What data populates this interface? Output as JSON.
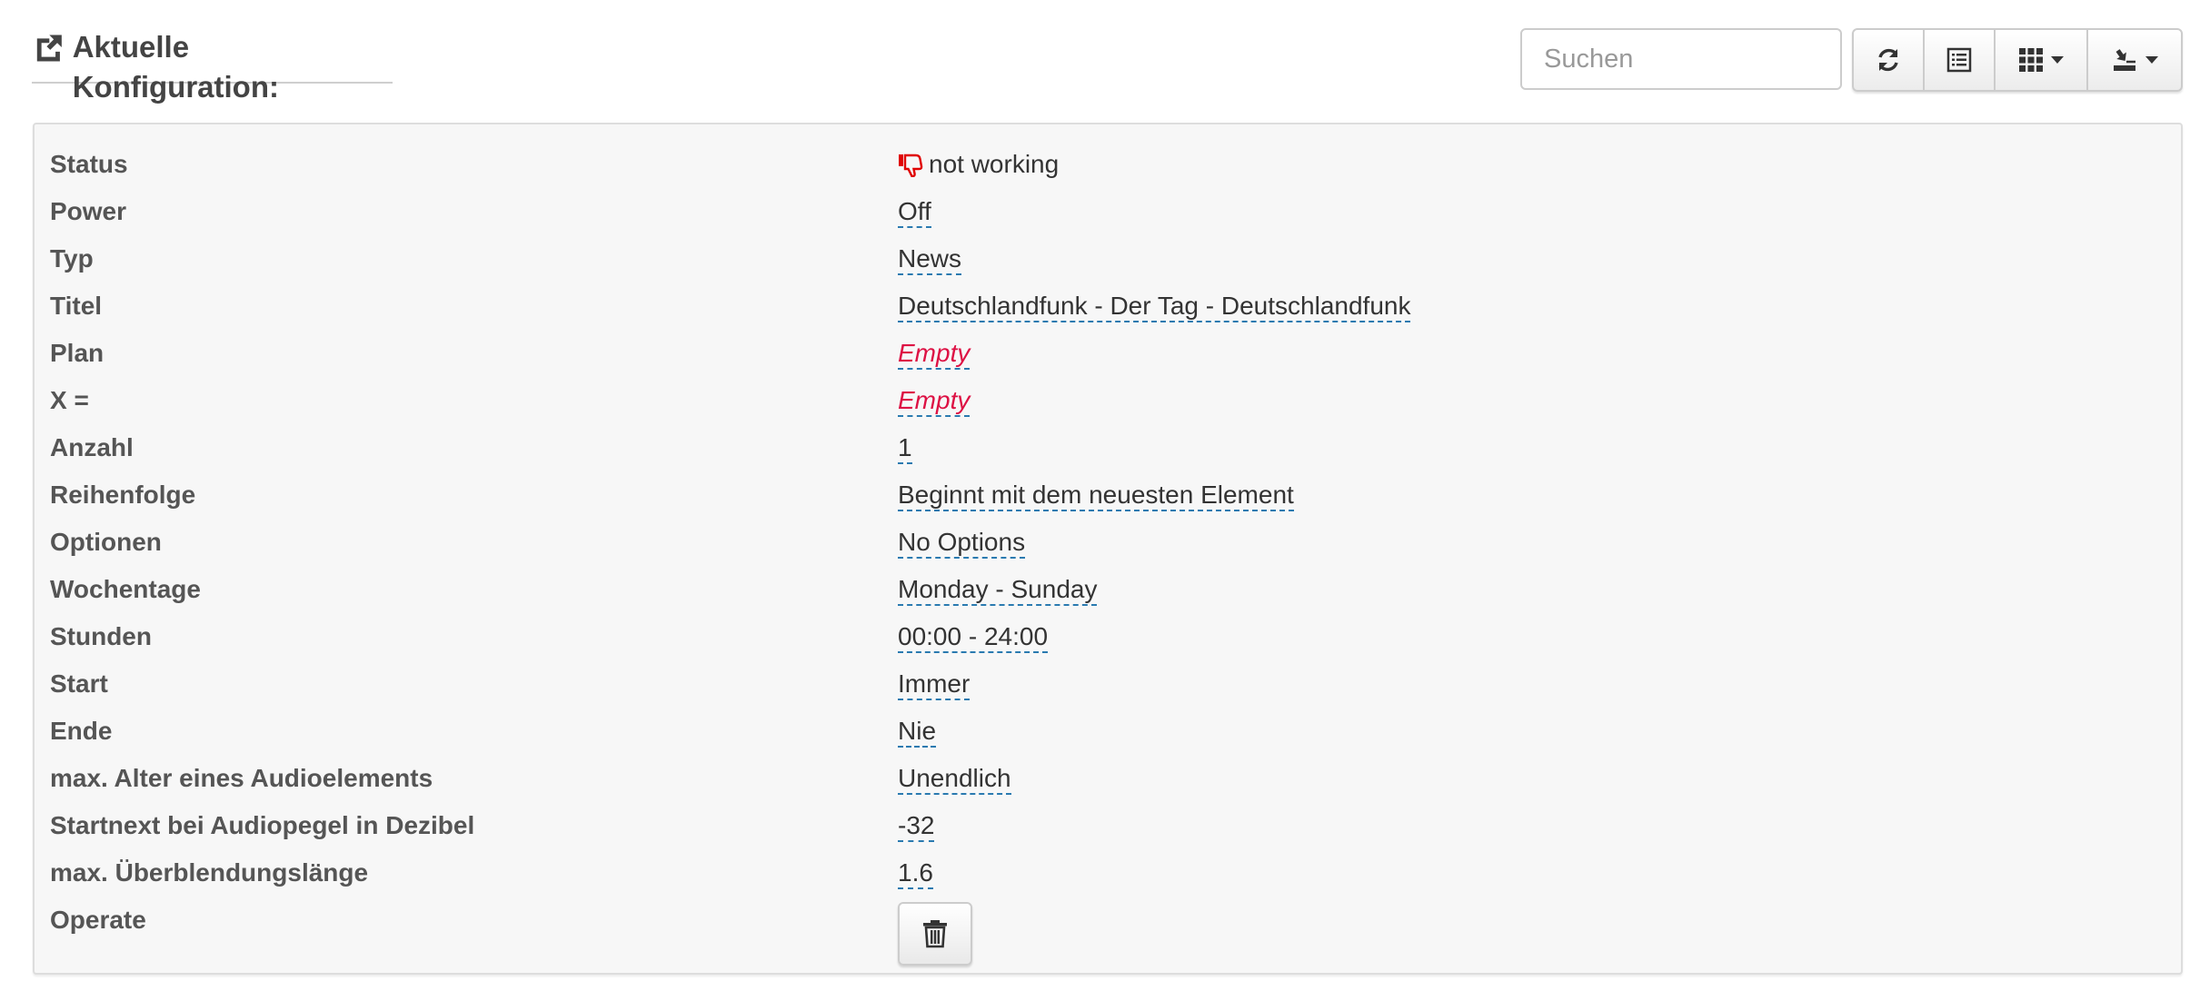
{
  "header": {
    "title": "Aktuelle Konfiguration:",
    "icon": "share-square-icon"
  },
  "toolbar": {
    "search_placeholder": "Suchen",
    "buttons": [
      {
        "icon": "refresh-icon"
      },
      {
        "icon": "list-view-icon"
      },
      {
        "icon": "columns-grid-icon",
        "dropdown": true
      },
      {
        "icon": "export-icon",
        "dropdown": true
      }
    ]
  },
  "colors": {
    "status_error": "#e00000",
    "empty_value": "#dd1144",
    "editable_underline": "#2a7ab0",
    "panel_background": "#f7f7f7"
  },
  "config": {
    "rows": [
      {
        "label": "Status",
        "value": "not working",
        "icon": "thumbs-down-icon"
      },
      {
        "label": "Power",
        "value": "Off"
      },
      {
        "label": "Typ",
        "value": "News"
      },
      {
        "label": "Titel",
        "value": "Deutschlandfunk - Der Tag - Deutschlandfunk"
      },
      {
        "label": "Plan",
        "value": "Empty"
      },
      {
        "label": "X =",
        "value": "Empty"
      },
      {
        "label": "Anzahl",
        "value": "1"
      },
      {
        "label": "Reihenfolge",
        "value": "Beginnt mit dem neuesten Element"
      },
      {
        "label": "Optionen",
        "value": "No Options"
      },
      {
        "label": "Wochentage",
        "value": "Monday - Sunday"
      },
      {
        "label": "Stunden",
        "value": "00:00 - 24:00"
      },
      {
        "label": "Start",
        "value": "Immer"
      },
      {
        "label": "Ende",
        "value": "Nie"
      },
      {
        "label": "max. Alter eines Audioelements",
        "value": "Unendlich"
      },
      {
        "label": "Startnext bei Audiopegel in Dezibel",
        "value": "-32"
      },
      {
        "label": "max. Überblendungslänge",
        "value": "1.6"
      },
      {
        "label": "Operate",
        "icon": "trash-icon"
      }
    ]
  }
}
